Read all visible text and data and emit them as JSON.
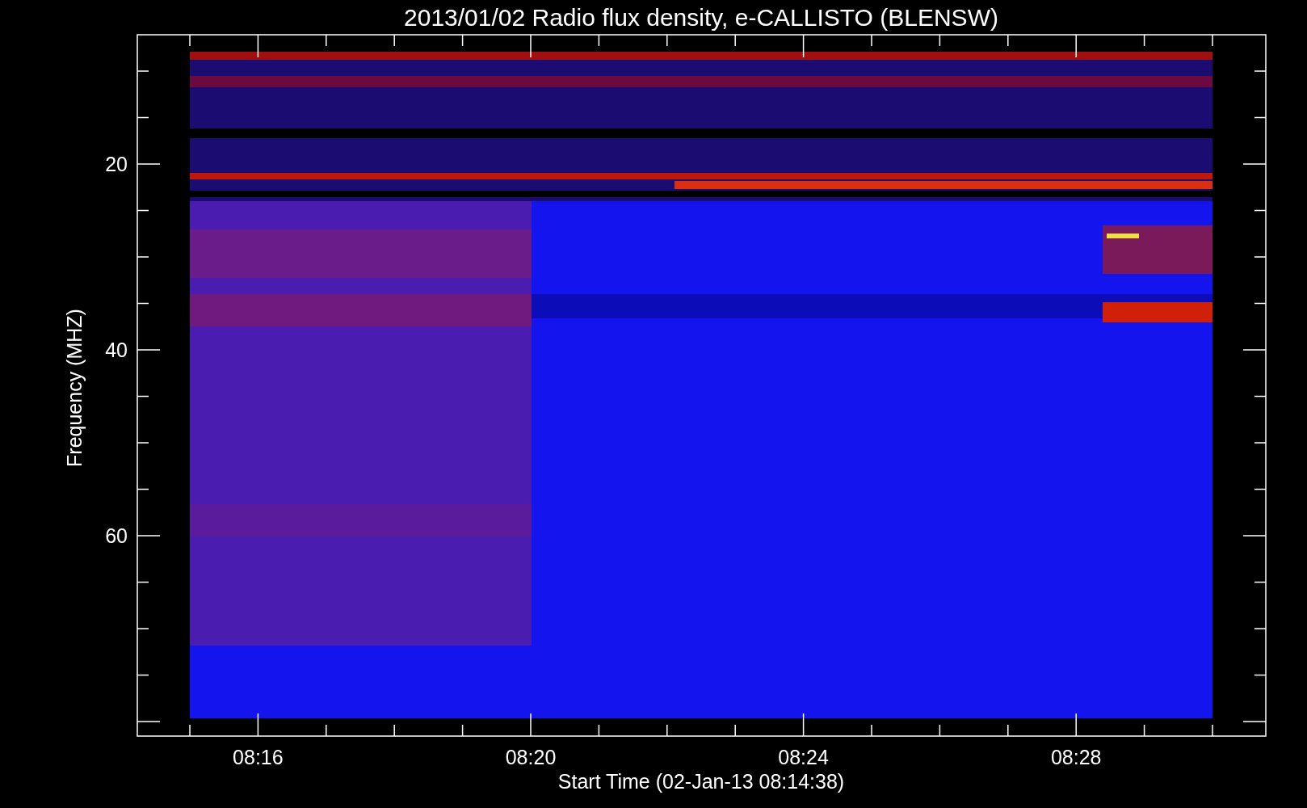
{
  "title": "2013/01/02  Radio flux density, e-CALLISTO (BLENSW)",
  "y_axis": {
    "label": "Frequency (MHZ)",
    "tick_labels": [
      "20",
      "40",
      "60"
    ]
  },
  "x_axis": {
    "label": "Start Time (02-Jan-13 08:14:38)",
    "tick_labels": [
      "08:16",
      "08:20",
      "08:24",
      "08:28"
    ]
  }
}
